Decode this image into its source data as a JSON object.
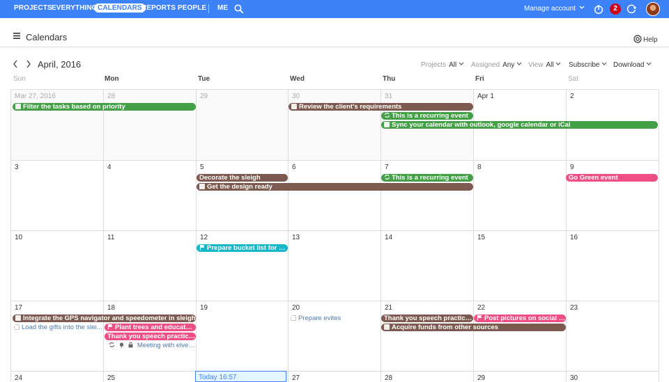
{
  "topnav": {
    "items": [
      "PROJECTS",
      "EVERYTHING",
      "CALENDARS",
      "REPORTS",
      "PEOPLE"
    ],
    "me": "ME",
    "manage_account": "Manage account",
    "notifications": "2",
    "accent": "#3e82f7"
  },
  "header": {
    "title": "Calendars",
    "help": "Help"
  },
  "toolbar": {
    "month": "April, 2016",
    "projects_label": "Projects",
    "projects_value": "All",
    "assigned_label": "Assigned",
    "assigned_value": "Any",
    "view_label": "View",
    "view_value": "All",
    "subscribe": "Subscribe",
    "download": "Download"
  },
  "days": [
    "Sun",
    "Mon",
    "Tue",
    "Wed",
    "Thu",
    "Fri",
    "Sat"
  ],
  "weeks": [
    [
      "Mar 27, 2016",
      "28",
      "29",
      "30",
      "31",
      "Apr 1",
      "2"
    ],
    [
      "3",
      "4",
      "5",
      "6",
      "7",
      "8",
      "9"
    ],
    [
      "10",
      "11",
      "12",
      "13",
      "14",
      "15",
      "16"
    ],
    [
      "17",
      "18",
      "19",
      "20",
      "21",
      "22",
      "23"
    ],
    [
      "24",
      "25",
      "Today 16:57",
      "27",
      "28",
      "29",
      "30"
    ]
  ],
  "events": {
    "e1": "Filter the tasks based on priority",
    "e2": "Review the client's requirements",
    "e3": "This is a recurring event",
    "e4": "Sync your calendar with outlook, google calendar or iCal",
    "e5": "Decorate the sleigh",
    "e6": "Get the design ready",
    "e7": "This is a recurring event",
    "e8": "Go Green event",
    "e9": "Prepare bucket list for Sa...",
    "e10": "Integrate the GPS navigator and speedometer in sleigh",
    "e11": "Load the gifts into the slei...",
    "e12": "Plant trees and educate c...",
    "e13": "Thank you speech practice s...",
    "e14": "Meeting with elves...",
    "e15": "Prepare evites",
    "e16": "Thank you speech practice s...",
    "e17": "Acquire funds from other sources",
    "e18": "Post pictures on social sit..."
  },
  "colors": {
    "green": "#43a047",
    "brown": "#7d5a4f",
    "pink": "#ee4d86",
    "cyan": "#17b6c9"
  }
}
